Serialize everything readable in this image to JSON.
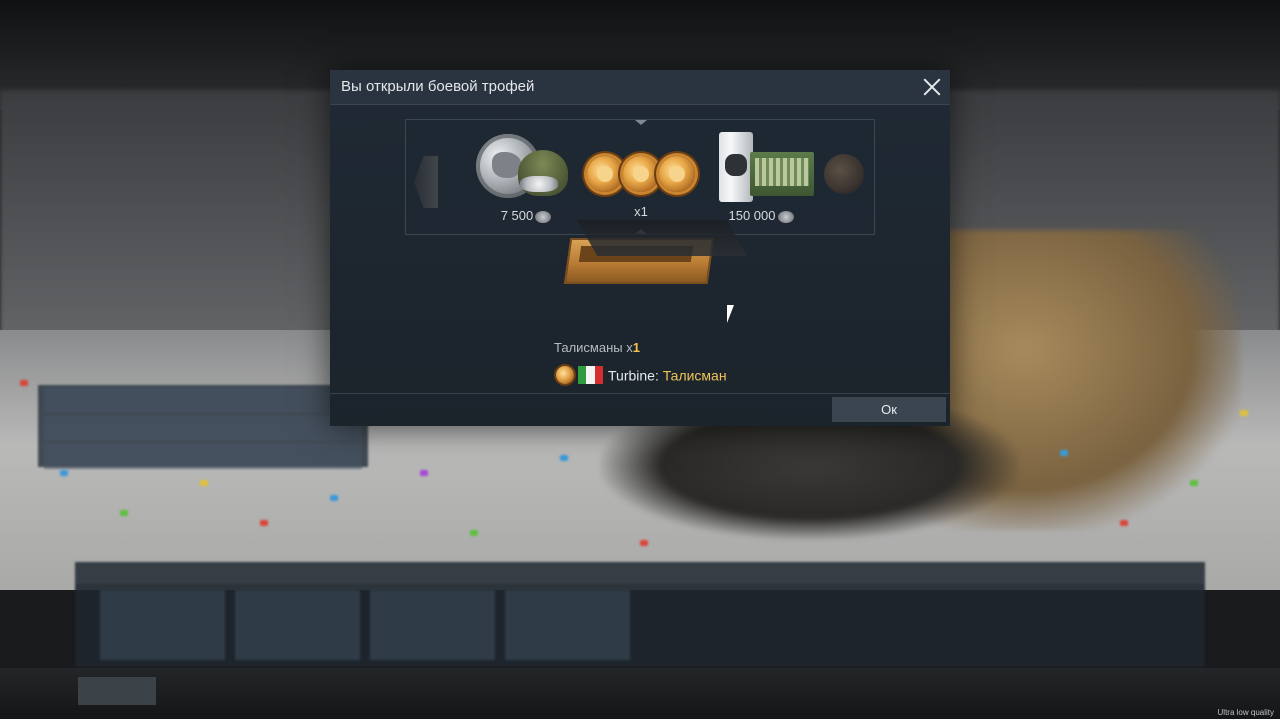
{
  "dialog": {
    "title": "Вы открыли боевой трофей",
    "close_icon": "close-icon"
  },
  "carousel": {
    "items": [
      {
        "name": "silver-lions",
        "label": "7 500",
        "currency_icon": "silver-lion-icon"
      },
      {
        "name": "talismans",
        "label": "x1"
      },
      {
        "name": "silver-lions-pack",
        "label": "150 000",
        "currency_icon": "silver-lion-icon"
      }
    ]
  },
  "reward": {
    "heading_text": "Талисманы x",
    "heading_count": "1",
    "vehicle_name": "Turbine:",
    "vehicle_type": "Талисман",
    "flag": {
      "name": "italy-flag",
      "colors": [
        "#2f9a3e",
        "#f4f4f4",
        "#d32f2f"
      ]
    }
  },
  "buttons": {
    "ok_label": "Ок"
  },
  "status": {
    "quality": "Ultra low quality"
  },
  "colors": {
    "accent_gold": "#f0c45a",
    "dialog_header": "#2a3440"
  }
}
